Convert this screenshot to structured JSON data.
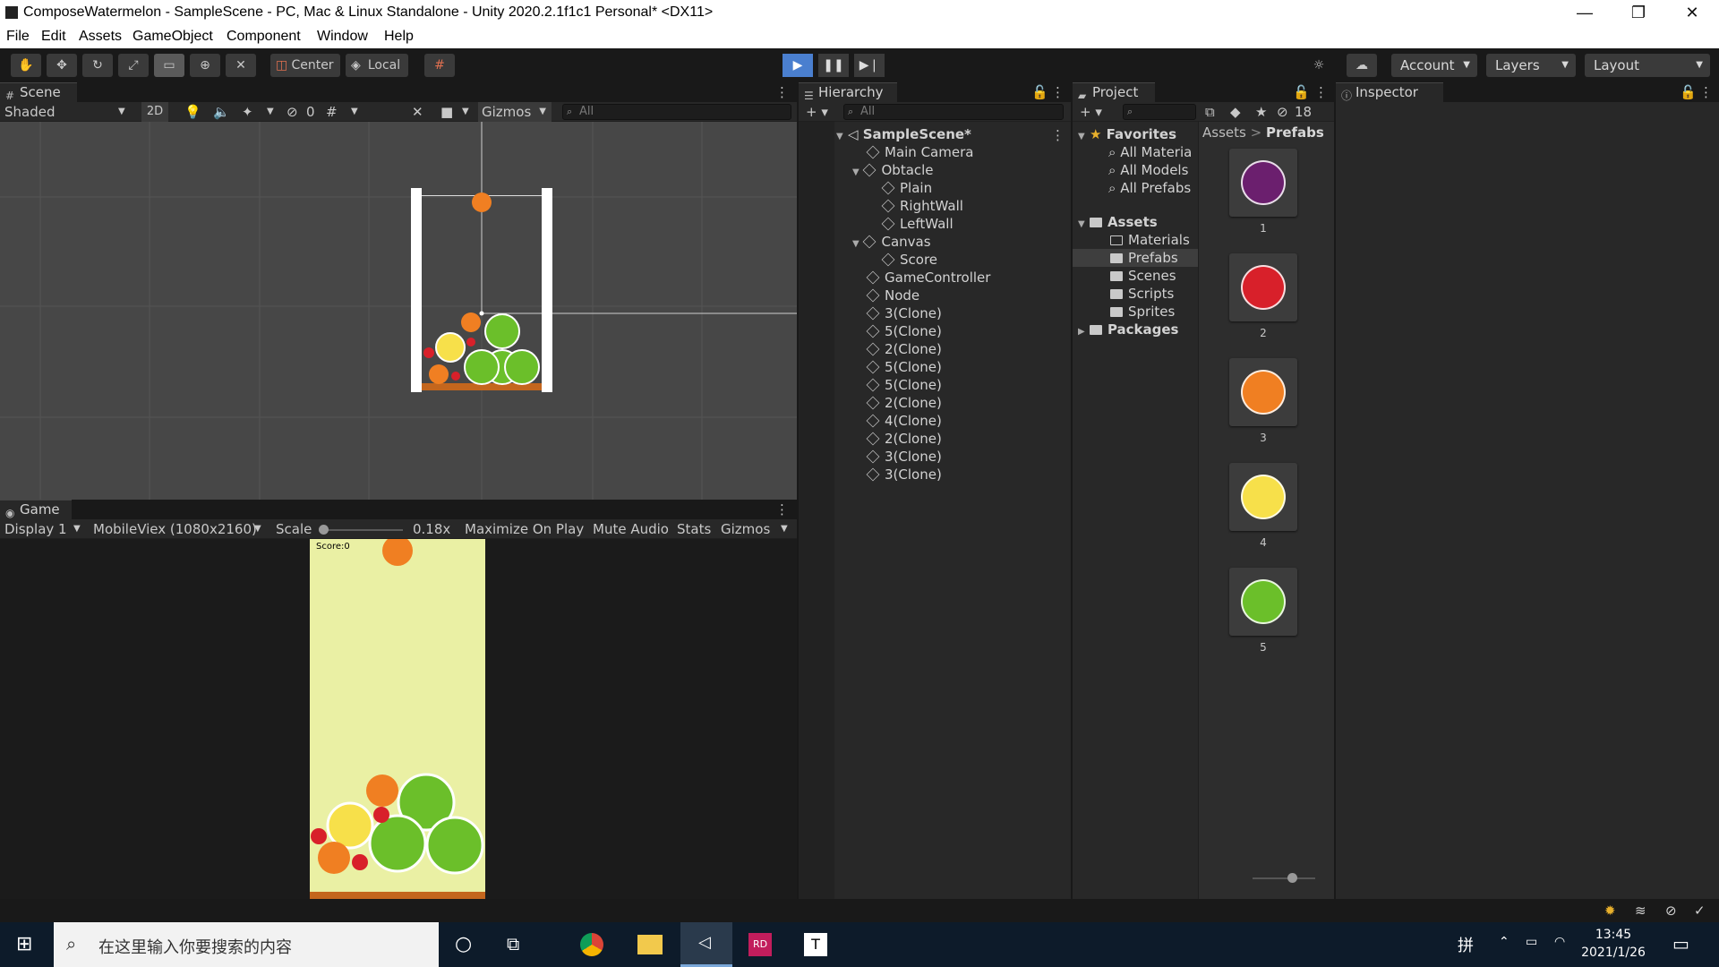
{
  "window": {
    "title": "ComposeWatermelon - SampleScene - PC, Mac & Linux Standalone - Unity 2020.2.1f1c1 Personal* <DX11>",
    "minimize": "—",
    "maximize": "❐",
    "close": "✕"
  },
  "menu": [
    "File",
    "Edit",
    "Assets",
    "GameObject",
    "Component",
    "Window",
    "Help"
  ],
  "toolbar": {
    "center_label": "Center",
    "local_label": "Local",
    "account_label": "Account",
    "layers_label": "Layers",
    "layout_label": "Layout"
  },
  "scene": {
    "tab": "Scene",
    "shading": "Shaded",
    "mode_2d": "2D",
    "hidden_count": "0",
    "gizmos": "Gizmos",
    "search_placeholder": "All"
  },
  "game": {
    "tab": "Game",
    "display": "Display 1",
    "resolution": "MobileViex (1080x2160)",
    "scale_label": "Scale",
    "scale_value": "0.18x",
    "maximize": "Maximize On Play",
    "mute": "Mute Audio",
    "stats": "Stats",
    "gizmos": "Gizmos",
    "score": "Score:0"
  },
  "hierarchy": {
    "tab": "Hierarchy",
    "search_placeholder": "All",
    "items": [
      {
        "label": "SampleScene*",
        "depth": 0,
        "scene": true
      },
      {
        "label": "Main Camera",
        "depth": 1
      },
      {
        "label": "Obtacle",
        "depth": 1,
        "expanded": true
      },
      {
        "label": "Plain",
        "depth": 2
      },
      {
        "label": "RightWall",
        "depth": 2
      },
      {
        "label": "LeftWall",
        "depth": 2
      },
      {
        "label": "Canvas",
        "depth": 1,
        "expanded": true
      },
      {
        "label": "Score",
        "depth": 2
      },
      {
        "label": "GameController",
        "depth": 1
      },
      {
        "label": "Node",
        "depth": 1
      },
      {
        "label": "3(Clone)",
        "depth": 1
      },
      {
        "label": "5(Clone)",
        "depth": 1
      },
      {
        "label": "2(Clone)",
        "depth": 1
      },
      {
        "label": "5(Clone)",
        "depth": 1
      },
      {
        "label": "5(Clone)",
        "depth": 1
      },
      {
        "label": "2(Clone)",
        "depth": 1
      },
      {
        "label": "4(Clone)",
        "depth": 1
      },
      {
        "label": "2(Clone)",
        "depth": 1
      },
      {
        "label": "3(Clone)",
        "depth": 1
      },
      {
        "label": "3(Clone)",
        "depth": 1
      }
    ]
  },
  "project": {
    "tab": "Project",
    "hidden_count": "18",
    "favorites": "Favorites",
    "favorite_items": [
      "All Materia",
      "All Models",
      "All Prefabs"
    ],
    "assets": "Assets",
    "asset_folders": [
      "Materials",
      "Prefabs",
      "Scenes",
      "Scripts",
      "Sprites"
    ],
    "packages": "Packages",
    "breadcrumb": [
      "Assets",
      "Prefabs"
    ],
    "breadcrumb_sep": ">",
    "prefabs": [
      {
        "label": "1",
        "color": "#6b1f6e"
      },
      {
        "label": "2",
        "color": "#d8202a"
      },
      {
        "label": "3",
        "color": "#f07f22"
      },
      {
        "label": "4",
        "color": "#f7e04a"
      },
      {
        "label": "5",
        "color": "#6bbf2a"
      }
    ]
  },
  "inspector": {
    "tab": "Inspector"
  },
  "taskbar": {
    "search_placeholder": "在这里输入你要搜索的内容",
    "time": "13:45",
    "date": "2021/1/26",
    "ime": "拼"
  }
}
